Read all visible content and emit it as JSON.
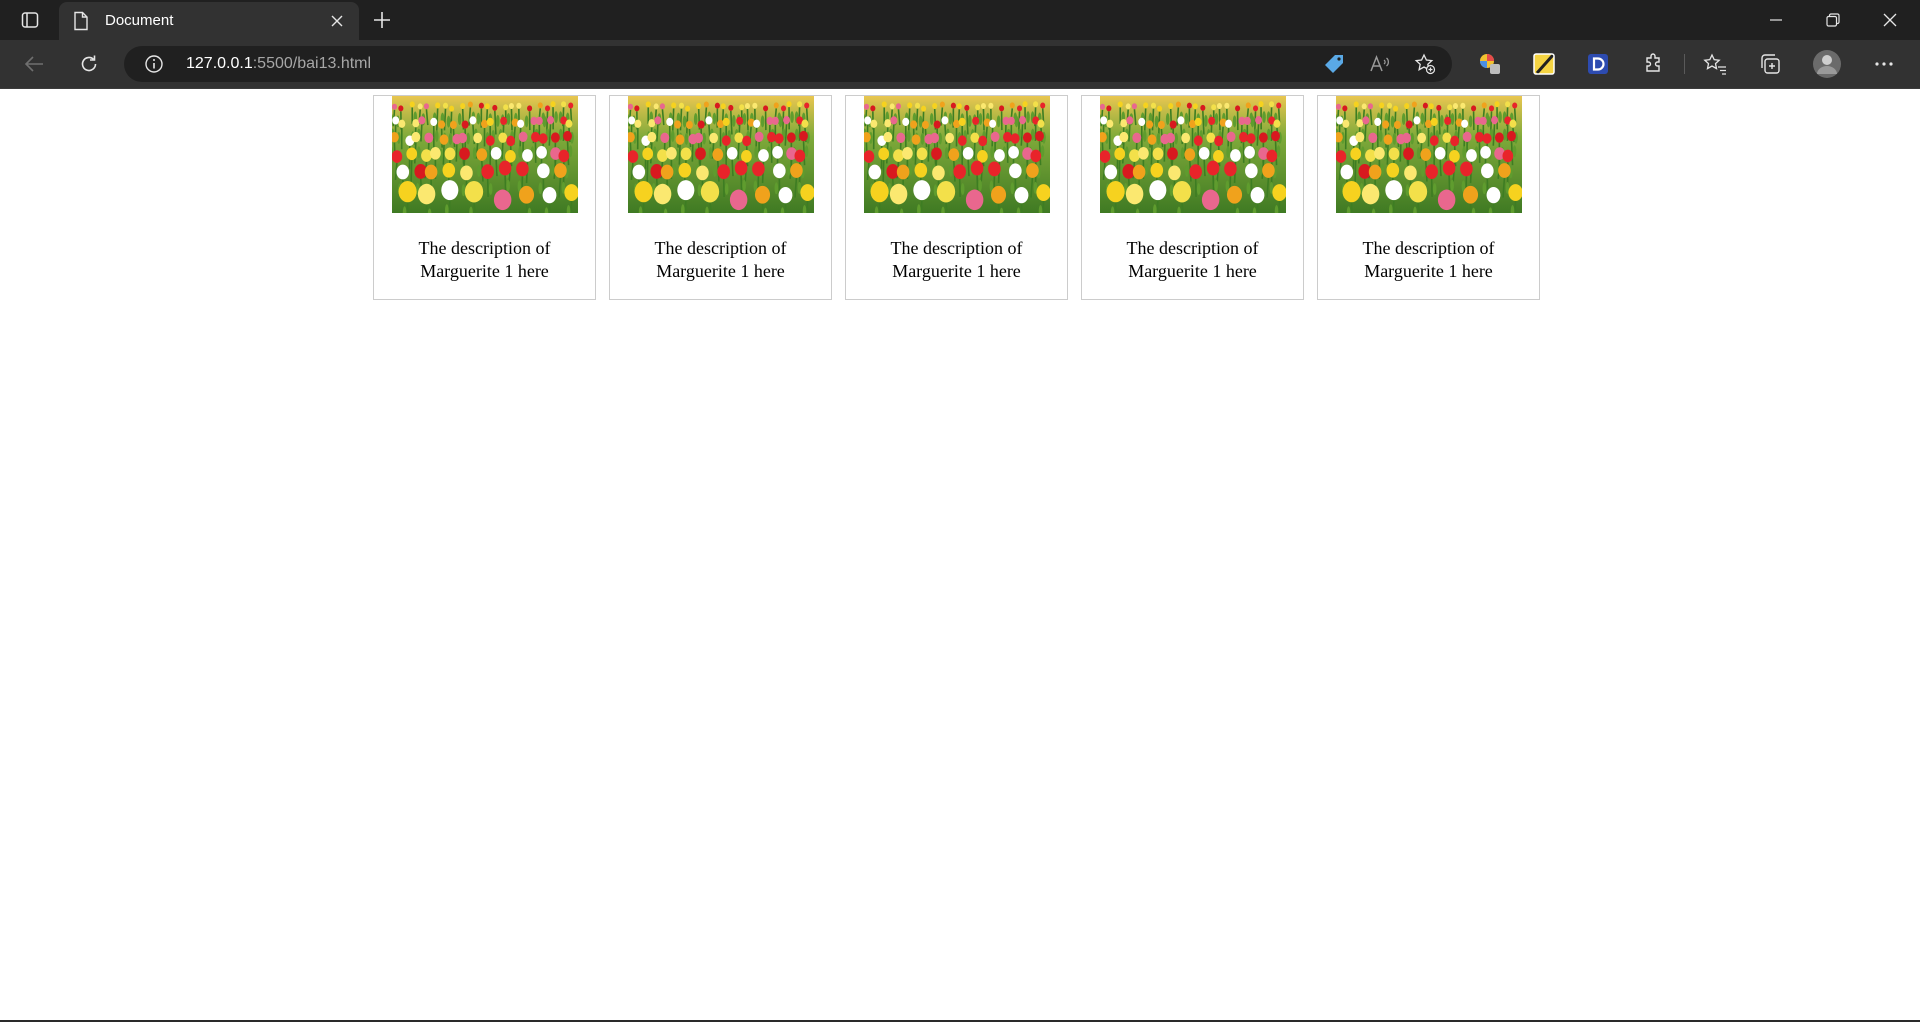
{
  "browser": {
    "tab": {
      "title": "Document"
    },
    "address": {
      "host": "127.0.0.1",
      "rest": ":5500/bai13.html"
    },
    "icons": {
      "tab_actions": "tab-actions-icon",
      "favicon": "document-icon",
      "close": "close-icon",
      "new_tab": "plus-icon",
      "back": "back-arrow-icon",
      "refresh": "refresh-icon",
      "info": "info-icon",
      "shopping": "tag-icon",
      "read_aloud": "read-aloud-icon",
      "add_favorite": "add-favorite-icon",
      "extensions": "puzzle-icon",
      "favorites": "favorites-icon",
      "collections": "collections-icon",
      "more": "more-icon"
    },
    "colors": {
      "chrome_dark": "#202020",
      "chrome_mid": "#323232",
      "link_blue": "#3b82c4"
    }
  },
  "gallery": {
    "items": [
      {
        "description": "The description of Marguerite 1 here"
      },
      {
        "description": "The description of Marguerite 1 here"
      },
      {
        "description": "The description of Marguerite 1 here"
      },
      {
        "description": "The description of Marguerite 1 here"
      },
      {
        "description": "The description of Marguerite 1 here"
      }
    ]
  }
}
